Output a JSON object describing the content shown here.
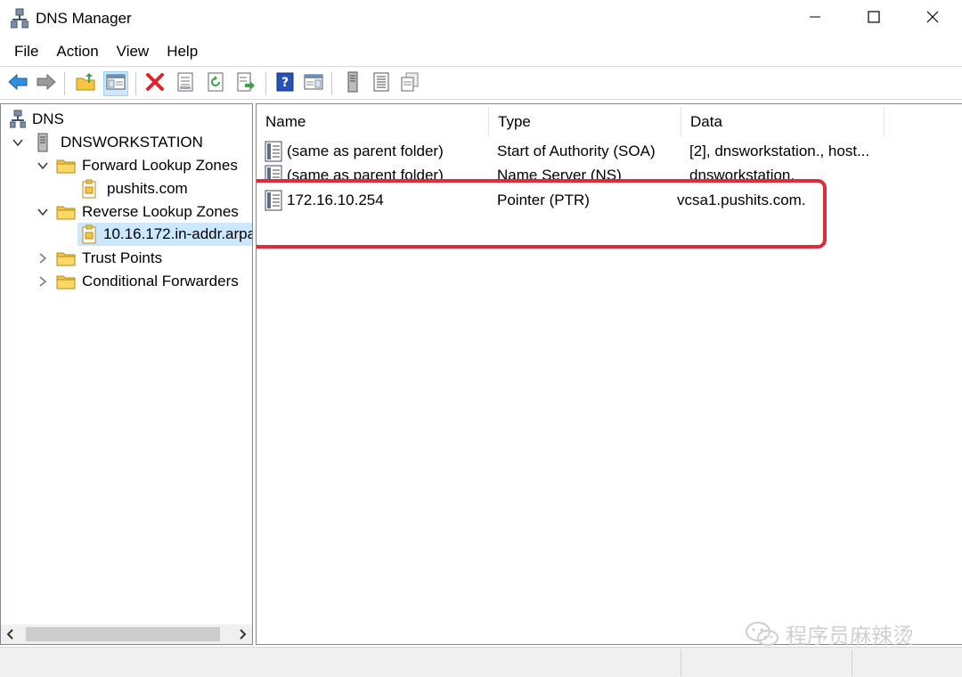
{
  "window": {
    "title": "DNS Manager",
    "minimize_glyph": "─",
    "maximize_glyph": "☐",
    "close_glyph": "✕"
  },
  "menu": [
    "File",
    "Action",
    "View",
    "Help"
  ],
  "toolbar": {
    "icons": [
      "back-arrow-icon",
      "forward-arrow-icon",
      "up-folder-icon",
      "show-tree-icon",
      "delete-icon",
      "properties-icon",
      "refresh-icon",
      "export-list-icon",
      "help-icon",
      "action-pane-icon",
      "server-icon",
      "record-list-icon",
      "copy-records-icon"
    ]
  },
  "tree": {
    "root": "DNS",
    "server": "DNSWORKSTATION",
    "forward_zones": "Forward Lookup Zones",
    "forward_zone_1": "pushits.com",
    "reverse_zones": "Reverse Lookup Zones",
    "reverse_zone_1": "10.16.172.in-addr.arpa",
    "trust_points": "Trust Points",
    "conditional_forwarders": "Conditional Forwarders"
  },
  "list": {
    "columns": [
      "Name",
      "Type",
      "Data"
    ],
    "rows": [
      {
        "name": "(same as parent folder)",
        "type": "Start of Authority (SOA)",
        "data": "[2], dnsworkstation., host..."
      },
      {
        "name": "(same as parent folder)",
        "type": "Name Server (NS)",
        "data": "dnsworkstation."
      },
      {
        "name": "172.16.10.254",
        "type": "Pointer (PTR)",
        "data": "vcsa1.pushits.com."
      }
    ]
  },
  "watermark": {
    "text": "程序员麻辣烫"
  },
  "colors": {
    "selection": "#cce8ff",
    "highlight_box": "#e02b3b",
    "folder": "#f5c542"
  }
}
